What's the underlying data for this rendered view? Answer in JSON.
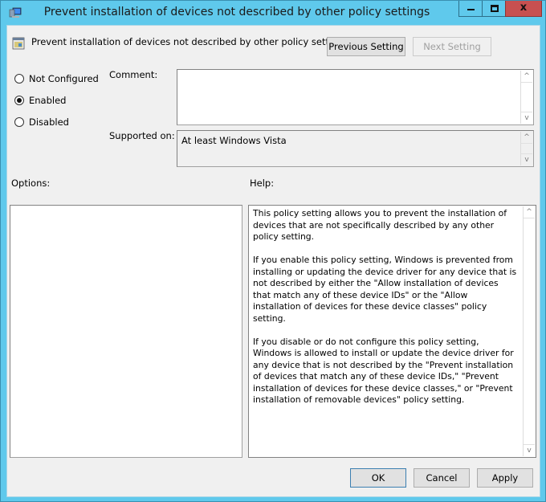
{
  "window": {
    "title": "Prevent installation of devices not described by other policy settings",
    "icons": {
      "app": "computer-policy-icon",
      "minimize": "minimize-icon",
      "maximize": "maximize-icon",
      "close": "close-icon"
    },
    "close_glyph": "x",
    "frame_color": "#5fc9ec",
    "close_color": "#c75050"
  },
  "header": {
    "policy_name": "Prevent installation of devices not described by other policy settings",
    "policy_icon": "policy-setting-icon",
    "previous_setting_label": "Previous Setting",
    "next_setting_label": "Next Setting",
    "next_setting_disabled": true
  },
  "state": {
    "options": [
      {
        "label": "Not Configured",
        "checked": false
      },
      {
        "label": "Enabled",
        "checked": true
      },
      {
        "label": "Disabled",
        "checked": false
      }
    ]
  },
  "comment": {
    "label": "Comment:",
    "value": ""
  },
  "supported": {
    "label": "Supported on:",
    "value": "At least Windows Vista"
  },
  "options_panel": {
    "label": "Options:"
  },
  "help_panel": {
    "label": "Help:",
    "paragraphs": [
      "This policy setting allows you to prevent the installation of devices that are not specifically described by any other policy setting.",
      "If you enable this policy setting, Windows is prevented from installing or updating the device driver for any device that is not described by either the \"Allow installation of devices that match any of these device IDs\" or the \"Allow installation of devices for these device classes\" policy setting.",
      "If you disable or do not configure this policy setting, Windows is allowed to install or update the device driver for any device that is not described by the \"Prevent installation of devices that match any of these device IDs,\" \"Prevent installation of devices for these device classes,\" or \"Prevent installation of removable devices\" policy setting."
    ]
  },
  "footer": {
    "ok_label": "OK",
    "cancel_label": "Cancel",
    "apply_label": "Apply"
  },
  "scroll_glyphs": {
    "up": "^",
    "down": "v"
  }
}
